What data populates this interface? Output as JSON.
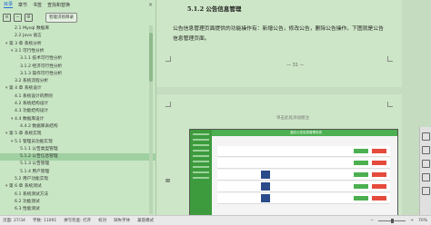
{
  "nav": {
    "tabs": [
      "目录",
      "章节",
      "书签",
      "查找和替换"
    ],
    "ocr_label": "智能识别目录"
  },
  "toc": [
    {
      "label": "2.1 Mysql 数据库",
      "indent": 1
    },
    {
      "label": "2.2 Java 语言",
      "indent": 1
    },
    {
      "label": "第 3 章  系统分析",
      "indent": 0,
      "arrow": "▾"
    },
    {
      "label": "3.1 可行性分析",
      "indent": 1,
      "arrow": "▾"
    },
    {
      "label": "3.1.1 技术可行性分析",
      "indent": 2
    },
    {
      "label": "3.1.2 经济可行性分析",
      "indent": 2
    },
    {
      "label": "3.1.3 操作可行性分析",
      "indent": 2
    },
    {
      "label": "3.2 系统流程分析",
      "indent": 1
    },
    {
      "label": "第 4 章  系统设计",
      "indent": 0,
      "arrow": "▾"
    },
    {
      "label": "4.1 系统设计的原则",
      "indent": 1
    },
    {
      "label": "4.2 系统结构设计",
      "indent": 1
    },
    {
      "label": "4.3 功能结构设计",
      "indent": 1
    },
    {
      "label": "4.4 数据库设计",
      "indent": 1,
      "arrow": "▾"
    },
    {
      "label": "4.4.2 数据库表结构",
      "indent": 2
    },
    {
      "label": "第 5 章  系统实现",
      "indent": 0,
      "arrow": "▾"
    },
    {
      "label": "5.1 管理员功能实现",
      "indent": 1,
      "arrow": "▾"
    },
    {
      "label": "5.1.1 公告类型管理",
      "indent": 2
    },
    {
      "label": "5.1.2 公告信息管理",
      "indent": 2,
      "selected": true
    },
    {
      "label": "5.1.3 公告管理",
      "indent": 2
    },
    {
      "label": "5.1.4 用户管理",
      "indent": 2
    },
    {
      "label": "5.2 用户功能实现",
      "indent": 1
    },
    {
      "label": "第 6 章  系统测试",
      "indent": 0,
      "arrow": "▾"
    },
    {
      "label": "6.1 系统测试方法",
      "indent": 1
    },
    {
      "label": "6.2 功能测试",
      "indent": 1
    },
    {
      "label": "6.3 性能测试",
      "indent": 1
    }
  ],
  "document": {
    "heading": "5.1.2 公告信息管理",
    "paragraph": "公告信息管理页面提供的功能操作有：新增公告，修改公告，删除公告操作。下图就是公告信息管理页面。",
    "page_number": "— 31 —",
    "caption_placeholder": "单击此处添加图注",
    "screenshot_title": "酒店公告信息管理系统"
  },
  "status": {
    "page": "页面: 27/34",
    "words": "字数: 11091",
    "spell": "拼写检查: 打开",
    "proof": "校对",
    "font_missing": "缺失字体",
    "compat": "兼容模式",
    "zoom": "70%"
  }
}
